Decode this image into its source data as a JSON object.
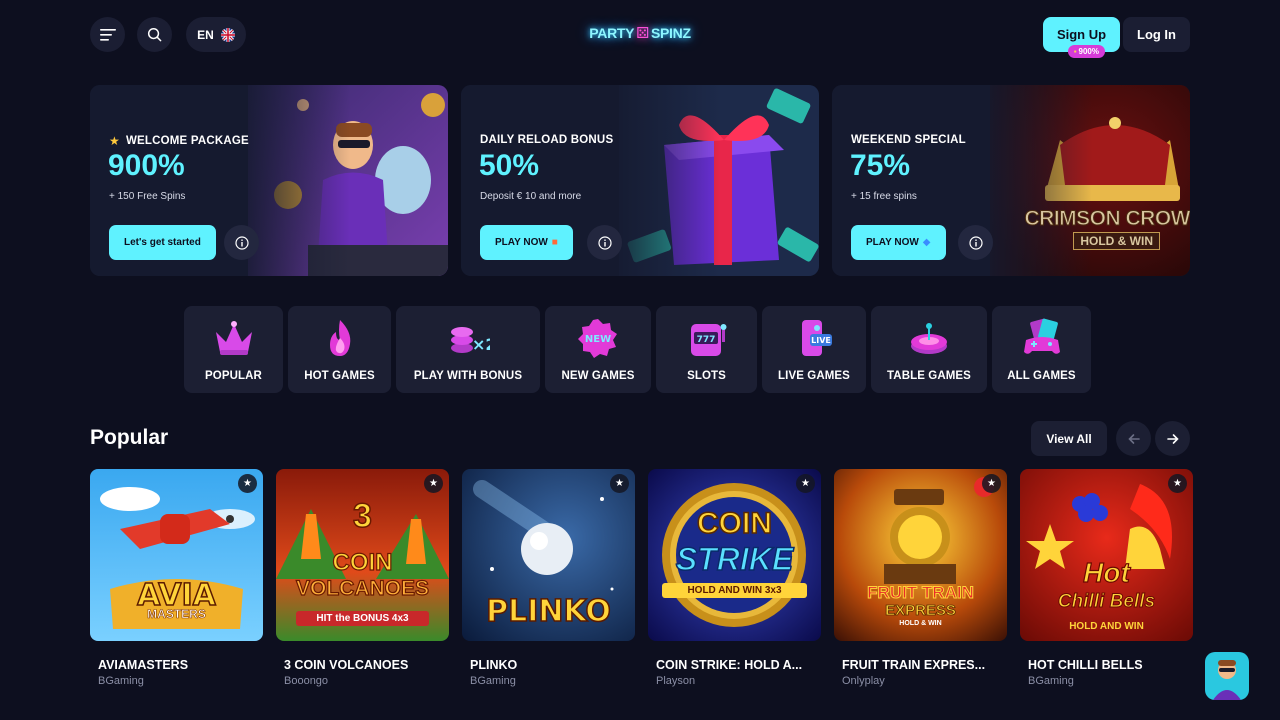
{
  "header": {
    "language": "EN",
    "logo": {
      "left": "PARTY",
      "right": "SPINZ"
    },
    "signup_label": "Sign Up",
    "signup_badge": "900%",
    "login_label": "Log In"
  },
  "promos": [
    {
      "label": "WELCOME PACKAGE",
      "value": "900%",
      "sub": "+ 150 Free Spins",
      "button": "Let's get started",
      "button_icon": ""
    },
    {
      "label": "DAILY RELOAD BONUS",
      "value": "50%",
      "sub": "Deposit € 10 and more",
      "button": "PLAY NOW",
      "button_icon": "gift-icon"
    },
    {
      "label": "WEEKEND SPECIAL",
      "value": "75%",
      "sub": "+ 15 free spins",
      "button": "PLAY NOW",
      "button_icon": "diamond-icon"
    }
  ],
  "promo_art_text": {
    "crown_line1": "CRIMSON CROW",
    "crown_line2": "HOLD & WIN"
  },
  "categories": [
    {
      "label": "POPULAR",
      "icon": "crown-icon"
    },
    {
      "label": "HOT GAMES",
      "icon": "flame-icon"
    },
    {
      "label": "PLAY WITH BONUS",
      "icon": "chips-x2-icon",
      "badge": "×2"
    },
    {
      "label": "NEW GAMES",
      "icon": "new-badge-icon",
      "badge": "NEW"
    },
    {
      "label": "SLOTS",
      "icon": "slot-machine-icon",
      "badge": "777"
    },
    {
      "label": "LIVE GAMES",
      "icon": "live-phone-icon",
      "badge": "LIVE"
    },
    {
      "label": "TABLE GAMES",
      "icon": "roulette-icon"
    },
    {
      "label": "ALL GAMES",
      "icon": "gamepad-cards-icon"
    }
  ],
  "popular": {
    "title": "Popular",
    "view_all": "View All",
    "games": [
      {
        "name": "AVIAMASTERS",
        "provider": "BGaming",
        "art_line1": "AVIA",
        "art_line2": "MASTERS"
      },
      {
        "name": "3 COIN VOLCANOES",
        "provider": "Booongo",
        "art_line1": "3",
        "art_line2": "COIN",
        "art_line3": "VOLCANOES",
        "art_line4": "HIT the BONUS 4x3"
      },
      {
        "name": "PLINKO",
        "provider": "BGaming",
        "art_line1": "PLINKO"
      },
      {
        "name": "COIN STRIKE: HOLD A...",
        "provider": "Playson",
        "art_line1": "COIN",
        "art_line2": "STRIKE",
        "art_line3": "HOLD AND WIN 3x3"
      },
      {
        "name": "FRUIT TRAIN EXPRES...",
        "provider": "Onlyplay",
        "art_line1": "FRUIT TRAIN",
        "art_line2": "EXPRESS",
        "art_line3": "HOLD & WIN"
      },
      {
        "name": "HOT CHILLI BELLS",
        "provider": "BGaming",
        "art_line1": "Hot",
        "art_line2": "Chilli Bells",
        "art_line3": "HOLD AND WIN"
      }
    ]
  },
  "colors": {
    "bg": "#0d0f1f",
    "accent": "#5ff2ff",
    "card": "#1c1f33",
    "pink": "#d63bd8"
  }
}
